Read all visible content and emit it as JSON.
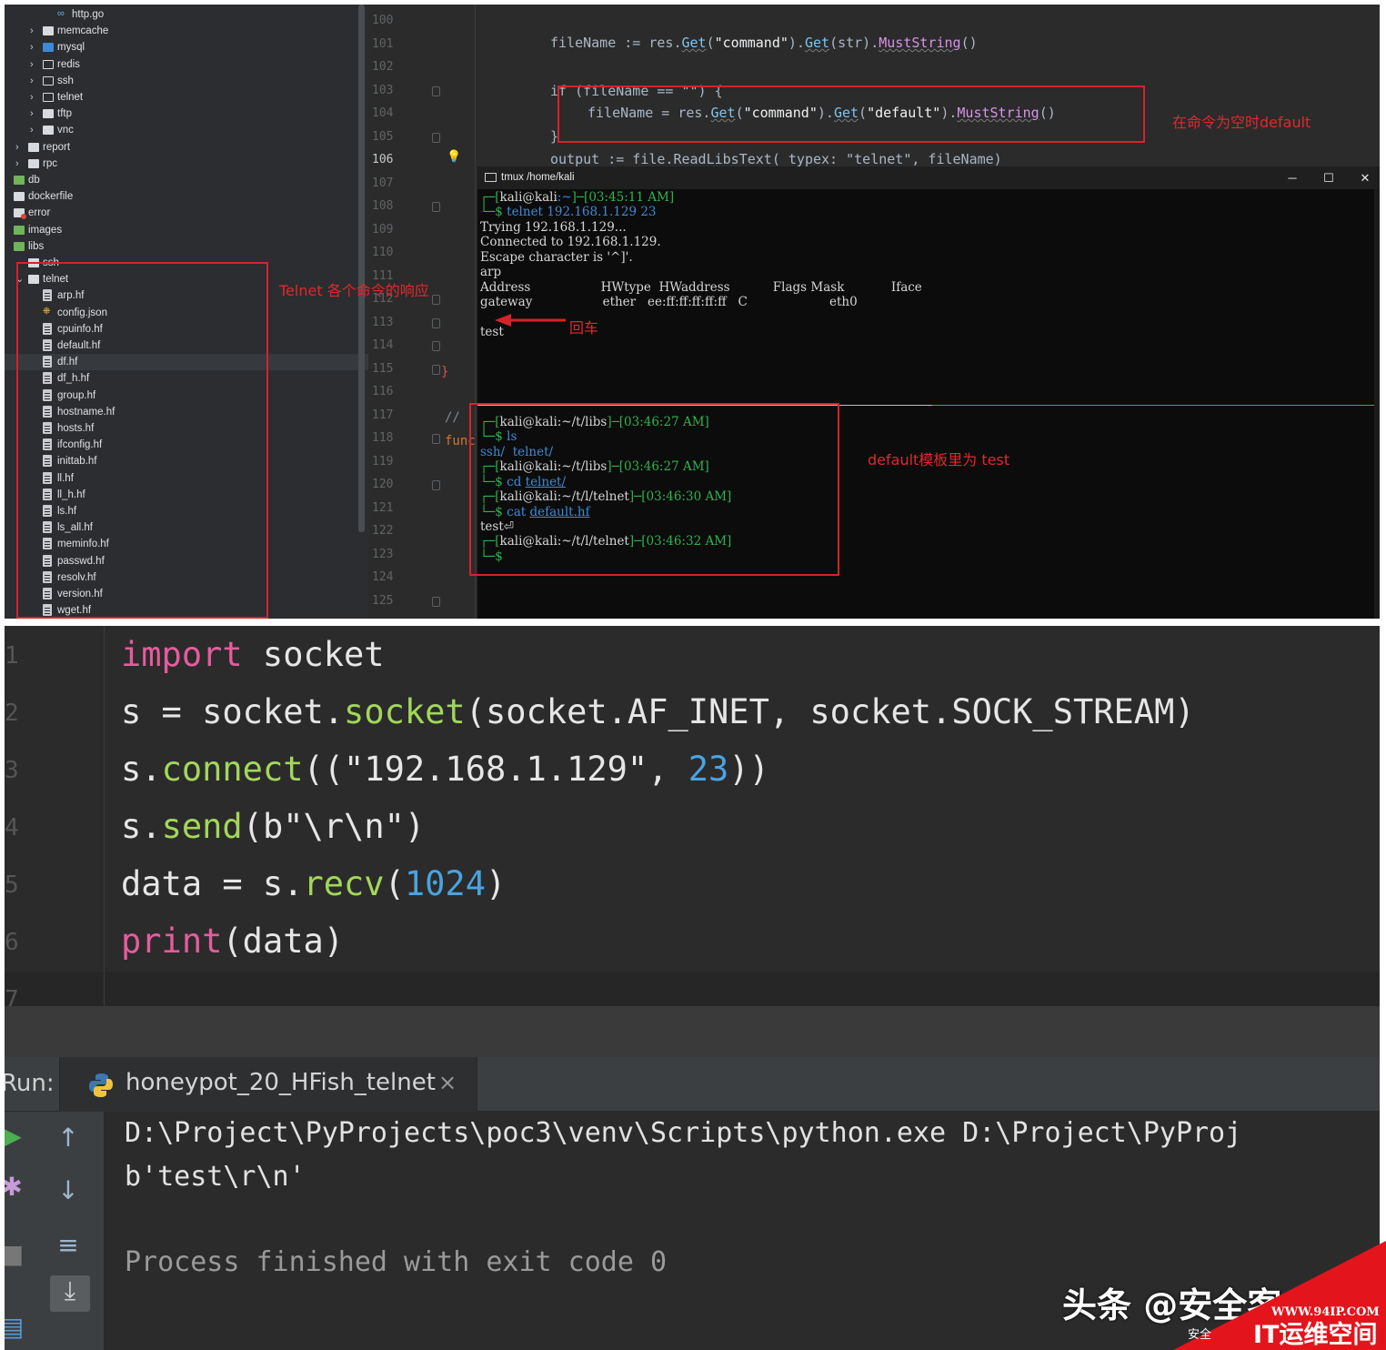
{
  "tree": {
    "items": [
      {
        "label": "http.go",
        "icon": "go-file-icon",
        "kind": "go",
        "level": 4,
        "chevron": ""
      },
      {
        "label": "memcache",
        "icon": "folder-icon",
        "kind": "folder",
        "level": 3,
        "chevron": "›"
      },
      {
        "label": "mysql",
        "icon": "folder-blue-icon",
        "kind": "folder-blue",
        "level": 3,
        "chevron": "›"
      },
      {
        "label": "redis",
        "icon": "folder-outline-icon",
        "kind": "folder-outline",
        "level": 3,
        "chevron": "›"
      },
      {
        "label": "ssh",
        "icon": "folder-outline-icon",
        "kind": "folder-outline",
        "level": 3,
        "chevron": "›"
      },
      {
        "label": "telnet",
        "icon": "folder-outline-icon",
        "kind": "folder-outline",
        "level": 3,
        "chevron": "›"
      },
      {
        "label": "tftp",
        "icon": "folder-icon",
        "kind": "folder",
        "level": 3,
        "chevron": "›"
      },
      {
        "label": "vnc",
        "icon": "folder-icon",
        "kind": "folder",
        "level": 3,
        "chevron": "›"
      },
      {
        "label": "report",
        "icon": "folder-icon",
        "kind": "folder",
        "level": 2,
        "chevron": "›"
      },
      {
        "label": "rpc",
        "icon": "folder-icon",
        "kind": "folder",
        "level": 2,
        "chevron": "›"
      },
      {
        "label": "db",
        "icon": "folder-green-icon",
        "kind": "folder-green",
        "level": 1,
        "chevron": ""
      },
      {
        "label": "dockerfile",
        "icon": "folder-icon",
        "kind": "folder",
        "level": 1,
        "chevron": ""
      },
      {
        "label": "error",
        "icon": "folder-error-icon",
        "kind": "folder-red",
        "level": 1,
        "chevron": ""
      },
      {
        "label": "images",
        "icon": "folder-green-icon",
        "kind": "folder-green",
        "level": 1,
        "chevron": ""
      },
      {
        "label": "libs",
        "icon": "folder-green-icon",
        "kind": "folder-green",
        "level": 1,
        "chevron": ""
      },
      {
        "label": "ssh",
        "icon": "folder-icon",
        "kind": "folder",
        "level": 2,
        "chevron": ""
      },
      {
        "label": "telnet",
        "icon": "folder-icon",
        "kind": "folder",
        "level": 2,
        "chevron": "⌄"
      },
      {
        "label": "arp.hf",
        "icon": "file-icon",
        "kind": "file",
        "level": 3,
        "chevron": ""
      },
      {
        "label": "config.json",
        "icon": "json-file-icon",
        "kind": "json",
        "level": 3,
        "chevron": ""
      },
      {
        "label": "cpuinfo.hf",
        "icon": "file-icon",
        "kind": "file",
        "level": 3,
        "chevron": ""
      },
      {
        "label": "default.hf",
        "icon": "file-icon",
        "kind": "file",
        "level": 3,
        "chevron": ""
      },
      {
        "label": "df.hf",
        "icon": "file-icon",
        "kind": "file",
        "level": 3,
        "chevron": "",
        "selected": true
      },
      {
        "label": "df_h.hf",
        "icon": "file-icon",
        "kind": "file",
        "level": 3,
        "chevron": ""
      },
      {
        "label": "group.hf",
        "icon": "file-icon",
        "kind": "file",
        "level": 3,
        "chevron": ""
      },
      {
        "label": "hostname.hf",
        "icon": "file-icon",
        "kind": "file",
        "level": 3,
        "chevron": ""
      },
      {
        "label": "hosts.hf",
        "icon": "file-icon",
        "kind": "file",
        "level": 3,
        "chevron": ""
      },
      {
        "label": "ifconfig.hf",
        "icon": "file-icon",
        "kind": "file",
        "level": 3,
        "chevron": ""
      },
      {
        "label": "inittab.hf",
        "icon": "file-icon",
        "kind": "file",
        "level": 3,
        "chevron": ""
      },
      {
        "label": "ll.hf",
        "icon": "file-icon",
        "kind": "file",
        "level": 3,
        "chevron": ""
      },
      {
        "label": "ll_h.hf",
        "icon": "file-icon",
        "kind": "file",
        "level": 3,
        "chevron": ""
      },
      {
        "label": "ls.hf",
        "icon": "file-icon",
        "kind": "file",
        "level": 3,
        "chevron": ""
      },
      {
        "label": "ls_all.hf",
        "icon": "file-icon",
        "kind": "file",
        "level": 3,
        "chevron": ""
      },
      {
        "label": "meminfo.hf",
        "icon": "file-icon",
        "kind": "file",
        "level": 3,
        "chevron": ""
      },
      {
        "label": "passwd.hf",
        "icon": "file-icon",
        "kind": "file",
        "level": 3,
        "chevron": ""
      },
      {
        "label": "resolv.hf",
        "icon": "file-icon",
        "kind": "file",
        "level": 3,
        "chevron": ""
      },
      {
        "label": "version.hf",
        "icon": "file-icon",
        "kind": "file",
        "level": 3,
        "chevron": ""
      },
      {
        "label": "wget.hf",
        "icon": "file-icon",
        "kind": "file",
        "level": 3,
        "chevron": ""
      }
    ]
  },
  "gutter": {
    "line_numbers": [
      "100",
      "101",
      "102",
      "103",
      "104",
      "105",
      "106",
      "107",
      "108",
      "109",
      "110",
      "111",
      "112",
      "113",
      "114",
      "115",
      "116",
      "117",
      "118",
      "119",
      "120",
      "121",
      "122",
      "123",
      "124",
      "125"
    ],
    "current_line": "106",
    "brace": "}",
    "comment": "//",
    "func_fragment": "func"
  },
  "editor": {
    "line101": {
      "a": "fileName := res.",
      "get1": "Get",
      "b": "(",
      "s1": "\"command\"",
      "c": ").",
      "get2": "Get",
      "d": "(str).",
      "ms": "MustString",
      "e": "()"
    },
    "line103": "if (fileName == \"\") {",
    "line104": {
      "a": "fileName = res.",
      "get1": "Get",
      "b": "(",
      "s1": "\"command\"",
      "c": ").",
      "get2": "Get",
      "d": "(",
      "s2": "\"default\"",
      "e": ").",
      "ms": "MustString",
      "f": "()"
    },
    "line105": "}",
    "line106": "output := file.ReadLibsText( typex: \"telnet\", fileName)"
  },
  "terminal": {
    "title": "tmux /home/kali",
    "btn_min": "─",
    "btn_max": "☐",
    "btn_close": "✕",
    "top_pane": {
      "prompt1": {
        "pre": "┌─[",
        "user": "kali@kali",
        "path": ":~",
        "mid": "]─[",
        "time": "03:45:11 AM",
        "end": "]"
      },
      "cmd1": {
        "pre": "└─$ ",
        "cmd": "telnet 192.168.1.129 23"
      },
      "out1": "Trying 192.168.1.129...",
      "out2": "Connected to 192.168.1.129.",
      "out3": "Escape character is '^]'.",
      "out4": "arp",
      "out5": "Address                  HWtype  HWaddress           Flags Mask            Iface",
      "out6": "gateway                  ether   ee:ff:ff:ff:ff:ff   C                     eth0",
      "out7": "test"
    },
    "bottom_pane": {
      "p1": {
        "pre": "┌─[",
        "user": "kali@kali",
        "path": ":~/t/libs",
        "mid": "]─[",
        "time": "03:46:27 AM",
        "end": "]"
      },
      "c1": {
        "pre": "└─$ ",
        "cmd": "ls"
      },
      "o1": {
        "a": "ssh/",
        "b": "  telnet/"
      },
      "p2": {
        "pre": "┌─[",
        "user": "kali@kali",
        "path": ":~/t/libs",
        "mid": "]─[",
        "time": "03:46:27 AM",
        "end": "]"
      },
      "c2": {
        "pre": "└─$ ",
        "cmd": "cd ",
        "arg": "telnet/"
      },
      "p3": {
        "pre": "┌─[",
        "user": "kali@kali",
        "path": ":~/t/l/telnet",
        "mid": "]─[",
        "time": "03:46:30 AM",
        "end": "]"
      },
      "c3": {
        "pre": "└─$ ",
        "cmd": "cat ",
        "arg": "default.hf"
      },
      "o3": "test⏎",
      "p4": {
        "pre": "┌─[",
        "user": "kali@kali",
        "path": ":~/t/l/telnet",
        "mid": "]─[",
        "time": "03:46:32 AM",
        "end": "]"
      },
      "c4": {
        "pre": "└─$",
        "cmd": ""
      }
    }
  },
  "annotations": {
    "default_when_empty": "在命令为空时default",
    "telnet_responses": "Telnet 各个命令的响应",
    "enter": "回车",
    "default_template": "default模板里为 test"
  },
  "python": {
    "gutter": [
      "1",
      "2",
      "3",
      "4",
      "5",
      "6",
      "7"
    ],
    "l1": {
      "kw": "import",
      "rest": " socket"
    },
    "l2": {
      "a": "s = socket.",
      "fn": "socket",
      "b": "(socket.AF_INET, socket.SOCK_STREAM)"
    },
    "l3": {
      "a": "s.",
      "fn": "connect",
      "b": "((\"192.168.1.129\", ",
      "num": "23",
      "c": "))"
    },
    "l4": {
      "a": "s.",
      "fn": "send",
      "b": "(b\"\\r\\n\")"
    },
    "l5": {
      "a": "data = s.",
      "fn": "recv",
      "b": "(",
      "num": "1024",
      "c": ")"
    },
    "l6": {
      "kw": "print",
      "rest": "(data)"
    }
  },
  "run": {
    "label": "Run:",
    "tab": "honeypot_20_HFish_telnet",
    "close": "×",
    "out1": "D:\\Project\\PyProjects\\poc3\\venv\\Scripts\\python.exe D:\\Project\\PyProj",
    "out2": "b'test\\r\\n'",
    "out3": "Process finished with exit code 0"
  },
  "watermark": {
    "text": "头条 @安全客",
    "logo_url": "WWW.94IP.COM",
    "logo_text": "IT运维空间",
    "sub": "安全"
  },
  "colors": {
    "annotation_red": "#d4232b",
    "terminal_green": "#2fb24d",
    "terminal_blue": "#3c8bd8",
    "py_keyword": "#e55c9c",
    "py_function": "#a2d75a",
    "py_number": "#4aa3e0"
  }
}
